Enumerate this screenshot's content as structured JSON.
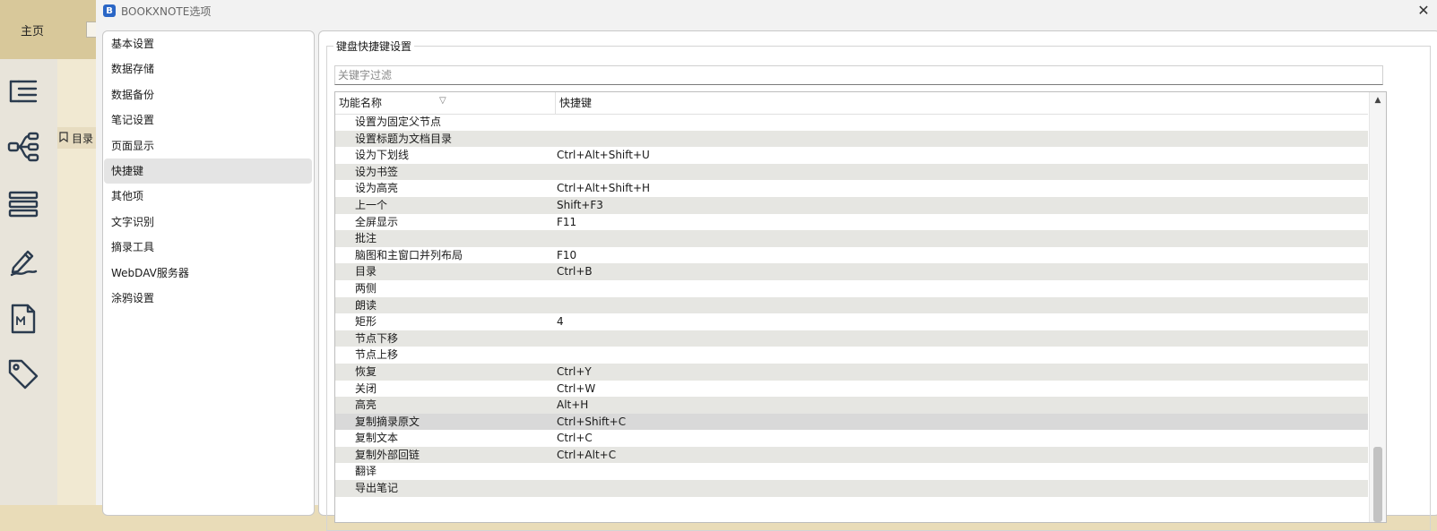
{
  "app": {
    "home_tab": "主页",
    "toc_label": "目录"
  },
  "dialog": {
    "title": "BOOKXNOTE选项",
    "logo": "B",
    "close": "✕"
  },
  "nav": {
    "items": [
      {
        "label": "基本设置"
      },
      {
        "label": "数据存储"
      },
      {
        "label": "数据备份"
      },
      {
        "label": "笔记设置"
      },
      {
        "label": "页面显示"
      },
      {
        "label": "快捷键",
        "active": true
      },
      {
        "label": "其他项"
      },
      {
        "label": "文字识别"
      },
      {
        "label": "摘录工具"
      },
      {
        "label": "WebDAV服务器"
      },
      {
        "label": "涂鸦设置"
      }
    ]
  },
  "shortcuts": {
    "group_title": "键盘快捷键设置",
    "filter_placeholder": "关键字过滤",
    "filter_value": "",
    "columns": [
      "功能名称",
      "快捷键"
    ],
    "rows": [
      {
        "name": "设置为固定父节点",
        "key": ""
      },
      {
        "name": "设置标题为文档目录",
        "key": ""
      },
      {
        "name": "设为下划线",
        "key": "Ctrl+Alt+Shift+U"
      },
      {
        "name": "设为书签",
        "key": ""
      },
      {
        "name": "设为高亮",
        "key": "Ctrl+Alt+Shift+H"
      },
      {
        "name": "上一个",
        "key": "Shift+F3"
      },
      {
        "name": "全屏显示",
        "key": "F11"
      },
      {
        "name": "批注",
        "key": ""
      },
      {
        "name": "脑图和主窗口并列布局",
        "key": "F10"
      },
      {
        "name": "目录",
        "key": "Ctrl+B"
      },
      {
        "name": "两侧",
        "key": ""
      },
      {
        "name": "朗读",
        "key": ""
      },
      {
        "name": "矩形",
        "key": "4"
      },
      {
        "name": "节点下移",
        "key": ""
      },
      {
        "name": "节点上移",
        "key": ""
      },
      {
        "name": "恢复",
        "key": "Ctrl+Y"
      },
      {
        "name": "关闭",
        "key": "Ctrl+W"
      },
      {
        "name": "高亮",
        "key": "Alt+H"
      },
      {
        "name": "复制摘录原文",
        "key": "Ctrl+Shift+C",
        "selected": true
      },
      {
        "name": "复制文本",
        "key": "Ctrl+C"
      },
      {
        "name": "复制外部回链",
        "key": "Ctrl+Alt+C"
      },
      {
        "name": "翻译",
        "key": ""
      },
      {
        "name": "导出笔记",
        "key": ""
      }
    ]
  },
  "icons": {
    "sidebar": [
      "outline-icon",
      "mindmap-icon",
      "list-icon",
      "pen-icon",
      "markdown-icon",
      "tag-icon"
    ],
    "scroll_up": "▲",
    "sort_indicator": "▽"
  }
}
